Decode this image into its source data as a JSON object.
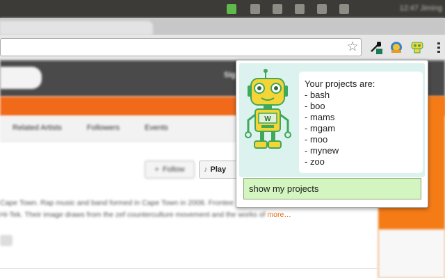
{
  "os_bar": {
    "clock": "12:47",
    "user": "Jiming"
  },
  "page": {
    "sign_label": "Sig",
    "tabs": [
      "Related Artists",
      "Followers",
      "Events"
    ],
    "follow_label": "Follow",
    "play_label": "Play",
    "bio_line1": "Cape Town. Rap music and band formed in Cape Town in 2008. Frontee",
    "bio_line2": "Hi-Tek. Their image draws from the zef counterculture movement and the works of",
    "bio_more": "more…"
  },
  "popup": {
    "title": "Your projects are:",
    "projects": [
      "- bash",
      "- boo",
      "- mams",
      "- mgam",
      "- moo",
      "- mynew",
      "- zoo"
    ],
    "button_label": "show my projects",
    "colors": {
      "panel_bg": "#dcf2ef",
      "button_bg": "#d3f5bf",
      "robot_yellow": "#f4d535",
      "robot_green": "#3fa85a"
    }
  }
}
